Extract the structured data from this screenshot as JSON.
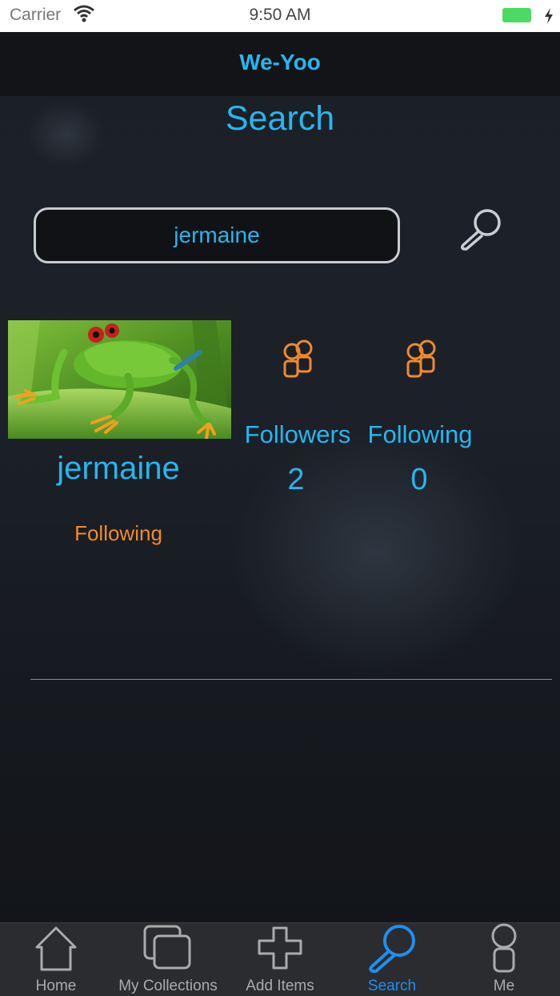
{
  "status_bar": {
    "carrier": "Carrier",
    "time": "9:50 AM"
  },
  "app": {
    "title": "We-Yoo"
  },
  "page": {
    "title": "Search"
  },
  "search": {
    "query": "jermaine"
  },
  "result": {
    "username": "jermaine",
    "follow_status": "Following",
    "followers_label": "Followers",
    "followers_count": "2",
    "following_label": "Following",
    "following_count": "0"
  },
  "tabbar": {
    "items": [
      {
        "label": "Home",
        "icon": "home-icon"
      },
      {
        "label": "My Collections",
        "icon": "collections-icon"
      },
      {
        "label": "Add Items",
        "icon": "plus-icon"
      },
      {
        "label": "Search",
        "icon": "search-icon"
      },
      {
        "label": "Me",
        "icon": "person-icon"
      }
    ],
    "active": "Search"
  },
  "colors": {
    "accent": "#27b6ee",
    "orange": "#f08a2c",
    "active_tab": "#1e8ff0",
    "battery": "#4cd964"
  }
}
